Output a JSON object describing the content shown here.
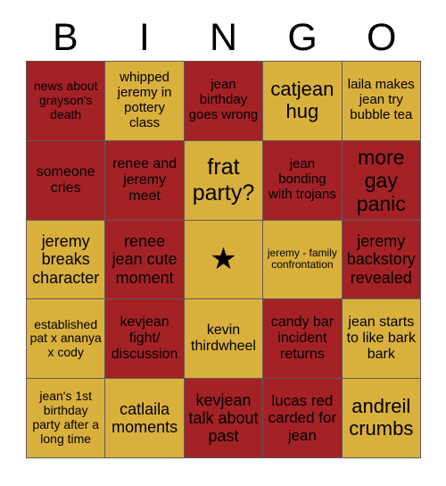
{
  "card": {
    "header_letters": [
      "B",
      "I",
      "N",
      "G",
      "O"
    ],
    "colors": {
      "red": "#A42226",
      "gold": "#D9B03C",
      "grid_line": "#5c5c5c",
      "text": "#000000",
      "background": "#ffffff"
    },
    "free_space_icon": "star-icon",
    "free_space_glyph": "★",
    "rows": [
      [
        {
          "text": "news about grayson's death",
          "color": "red",
          "font_size": 14
        },
        {
          "text": "whipped jeremy in pottery class",
          "color": "gold",
          "font_size": 15
        },
        {
          "text": "jean birthday goes wrong",
          "color": "red",
          "font_size": 15
        },
        {
          "text": "catjean hug",
          "color": "gold",
          "font_size": 22
        },
        {
          "text": "laila makes jean try bubble tea",
          "color": "gold",
          "font_size": 15
        }
      ],
      [
        {
          "text": "someone cries",
          "color": "red",
          "font_size": 16
        },
        {
          "text": "renee and jeremy meet",
          "color": "red",
          "font_size": 16
        },
        {
          "text": "frat party?",
          "color": "gold",
          "font_size": 25
        },
        {
          "text": "jean bonding with trojans",
          "color": "red",
          "font_size": 15
        },
        {
          "text": "more gay panic",
          "color": "red",
          "font_size": 23
        }
      ],
      [
        {
          "text": "jeremy breaks character",
          "color": "gold",
          "font_size": 18
        },
        {
          "text": "renee jean cute moment",
          "color": "red",
          "font_size": 18
        },
        {
          "text": "★",
          "color": "gold",
          "font_size": 34,
          "free": true
        },
        {
          "text": "jeremy - family confrontation",
          "color": "gold",
          "font_size": 12
        },
        {
          "text": "jeremy backstory revealed",
          "color": "red",
          "font_size": 18
        }
      ],
      [
        {
          "text": "established pat x ananya x cody",
          "color": "gold",
          "font_size": 14
        },
        {
          "text": "kevjean fight/ discussion",
          "color": "red",
          "font_size": 16
        },
        {
          "text": "kevin thirdwheel",
          "color": "gold",
          "font_size": 16
        },
        {
          "text": "candy bar incident returns",
          "color": "red",
          "font_size": 16
        },
        {
          "text": "jean starts to like bark bark",
          "color": "gold",
          "font_size": 16
        }
      ],
      [
        {
          "text": "jean's 1st birthday party after a long time",
          "color": "gold",
          "font_size": 14
        },
        {
          "text": "catlaila moments",
          "color": "gold",
          "font_size": 18
        },
        {
          "text": "kevjean talk about past",
          "color": "red",
          "font_size": 18
        },
        {
          "text": "lucas red carded for jean",
          "color": "red",
          "font_size": 17
        },
        {
          "text": "andreil crumbs",
          "color": "gold",
          "font_size": 22
        }
      ]
    ]
  }
}
